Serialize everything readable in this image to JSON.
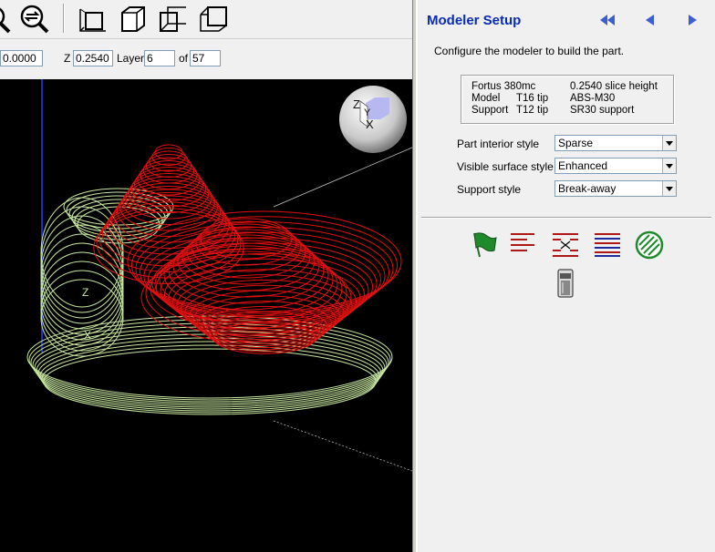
{
  "coords": {
    "x_value": "0.0000",
    "z_label": "Z",
    "z_value": "0.2540",
    "layer_label": "Layer",
    "layer_value": "6",
    "of_label": "of",
    "layer_total": "57"
  },
  "toolbar": {
    "icons": [
      "zoom-icon",
      "zoom-swap-icon",
      "view-front-icon",
      "view-iso-icon",
      "view-side-icon",
      "view-back-icon"
    ]
  },
  "panel": {
    "title": "Modeler Setup",
    "description": "Configure the modeler to build the part.",
    "printer": {
      "model": "Fortus 380mc",
      "slice": "0.2540 slice height",
      "model_label": "Model",
      "model_tip": "T16 tip",
      "model_material": "ABS-M30",
      "support_label": "Support",
      "support_tip": "T12 tip",
      "support_material": "SR30 support"
    },
    "settings": [
      {
        "label": "Part interior style",
        "value": "Sparse"
      },
      {
        "label": "Visible surface style",
        "value": "Enhanced"
      },
      {
        "label": "Support style",
        "value": "Break-away"
      }
    ],
    "tools": [
      "flag-icon",
      "toolpath-icon",
      "seam-icon",
      "layers-icon",
      "fill-pattern-icon",
      "canister-icon"
    ]
  },
  "colors": {
    "part": "#e01010",
    "support": "#c8e8a0",
    "title": "#0a2bb5",
    "nav": "#3b5fd0"
  }
}
